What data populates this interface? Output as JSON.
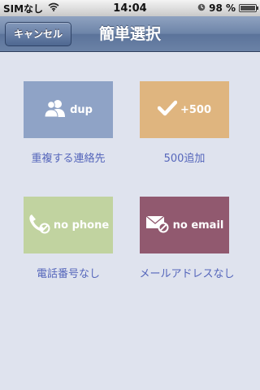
{
  "status_bar": {
    "carrier": "SIMなし",
    "time": "14:04",
    "battery_percent": "98 %",
    "battery_level": 0.98
  },
  "navbar": {
    "cancel_label": "キャンセル",
    "title": "簡単選択"
  },
  "tiles": [
    {
      "label": "dup",
      "caption": "重複する連絡先",
      "color": "#8fa3c6",
      "icon": "people-icon"
    },
    {
      "label": "+500",
      "caption": "500追加",
      "color": "#dfb57f",
      "icon": "checkmark-icon"
    },
    {
      "label": "no phone",
      "caption": "電話番号なし",
      "color": "#c1d3a0",
      "icon": "phone-prohibited-icon"
    },
    {
      "label": "no email",
      "caption": "メールアドレスなし",
      "color": "#91596f",
      "icon": "mail-prohibited-icon"
    }
  ],
  "colors": {
    "background": "#dfe3ee",
    "caption_text": "#5566bb"
  }
}
